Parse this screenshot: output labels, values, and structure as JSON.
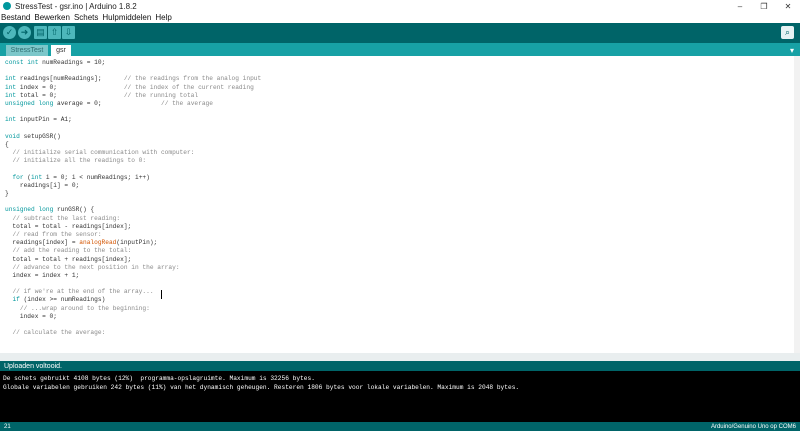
{
  "window": {
    "title": "StressTest - gsr.ino | Arduino 1.8.2",
    "controls": [
      "–",
      "❐",
      "✕"
    ]
  },
  "menu": [
    "Bestand",
    "Bewerken",
    "Schets",
    "Hulpmiddelen",
    "Help"
  ],
  "toolbar": {
    "verify_icon": "✓",
    "upload_icon": "➜",
    "new_icon": "▤",
    "open_icon": "⇧",
    "save_icon": "⇩",
    "serial_icon": "⌕"
  },
  "tabs": [
    {
      "label": "StressTest",
      "active": false
    },
    {
      "label": "gsr",
      "active": true
    }
  ],
  "tab_menu_icon": "▾",
  "code_lines": [
    "const int numReadings = 10;",
    "",
    "int readings[numReadings];      // the readings from the analog input",
    "int index = 0;                  // the index of the current reading",
    "int total = 0;                  // the running total",
    "unsigned long average = 0;                // the average",
    "",
    "int inputPin = A1;",
    "",
    "void setupGSR()",
    "{",
    "  // initialize serial communication with computer:",
    "  // initialize all the readings to 0:",
    "",
    "  for (int i = 0; i < numReadings; i++)",
    "    readings[i] = 0;",
    "}",
    "",
    "unsigned long runGSR() {",
    "  // subtract the last reading:",
    "  total = total - readings[index];",
    "  // read from the sensor:",
    "  readings[index] = analogRead(inputPin);",
    "  // add the reading to the total:",
    "  total = total + readings[index];",
    "  // advance to the next position in the array:",
    "  index = index + 1;",
    "",
    "  // if we're at the end of the array...",
    "  if (index >= numReadings)",
    "    // ...wrap around to the beginning:",
    "    index = 0;",
    "",
    "  // calculate the average:"
  ],
  "status": "Uploaden voltooid.",
  "console": [
    "De schets gebruikt 4108 bytes (12%)  programma-opslagruimte. Maximum is 32256 bytes.",
    "Globale variabelen gebruiken 242 bytes (11%) van het dynamisch geheugen. Resteren 1806 bytes voor lokale variabelen. Maximum is 2048 bytes."
  ],
  "footer": {
    "line_number": "21",
    "board": "Arduino/Genuino Uno op COM6"
  }
}
